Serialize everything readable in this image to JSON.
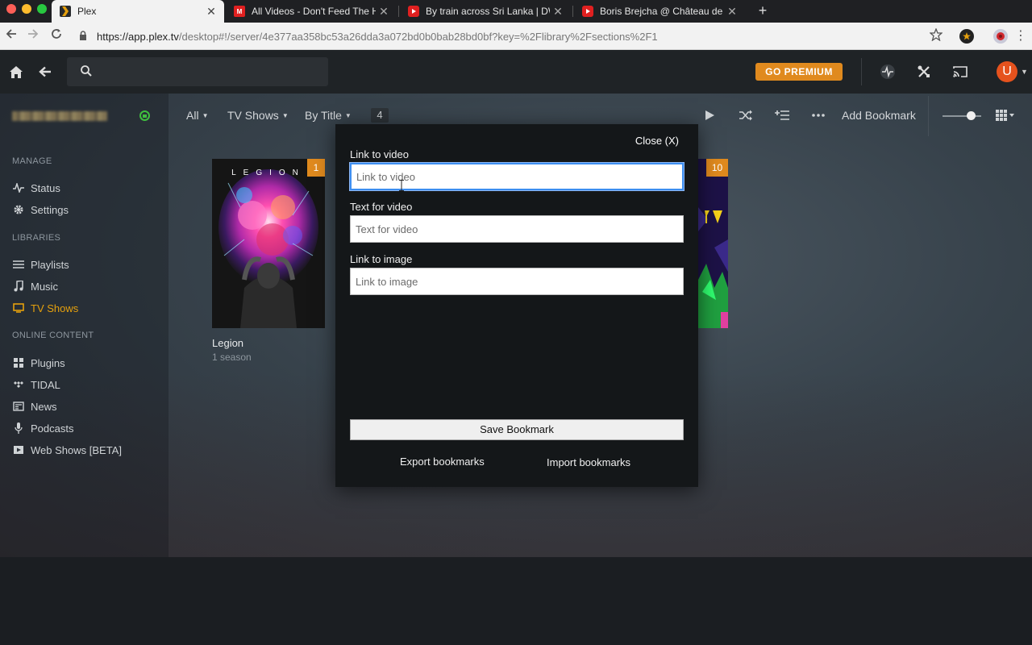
{
  "browser": {
    "tabs": [
      {
        "title": "Plex",
        "active": true,
        "favicon": "plex-icon"
      },
      {
        "title": "All Videos - Don't Feed The Hu",
        "active": false,
        "favicon": "mc-icon"
      },
      {
        "title": "By train across Sri Lanka | DW",
        "active": false,
        "favicon": "youtube-icon"
      },
      {
        "title": "Boris Brejcha @ Château de Fo",
        "active": false,
        "favicon": "youtube-icon"
      }
    ],
    "url_scheme": "https://",
    "url_host": "app.plex.tv",
    "url_rest": "/desktop#!/server/4e377aa358bc53a26dda3a072bd0b0bab28bd0bf?key=%2Flibrary%2Fsections%2F1"
  },
  "plex_header": {
    "premium_label": "GO PREMIUM",
    "avatar_letter": "U"
  },
  "sidebar": {
    "manage_label": "MANAGE",
    "manage_items": [
      {
        "label": "Status",
        "icon": "activity-icon"
      },
      {
        "label": "Settings",
        "icon": "gear-icon"
      }
    ],
    "libraries_label": "LIBRARIES",
    "library_items": [
      {
        "label": "Playlists",
        "icon": "list-icon"
      },
      {
        "label": "Music",
        "icon": "music-note-icon"
      },
      {
        "label": "TV Shows",
        "icon": "tv-icon",
        "active": true
      }
    ],
    "online_label": "ONLINE CONTENT",
    "online_items": [
      {
        "label": "Plugins",
        "icon": "grid-icon"
      },
      {
        "label": "TIDAL",
        "icon": "tidal-icon"
      },
      {
        "label": "News",
        "icon": "news-icon"
      },
      {
        "label": "Podcasts",
        "icon": "microphone-icon"
      },
      {
        "label": "Web Shows [BETA]",
        "icon": "play-box-icon"
      }
    ]
  },
  "toolbar": {
    "filter_all": "All",
    "filter_type": "TV Shows",
    "sort": "By Title",
    "count": "4",
    "add_bookmark": "Add Bookmark"
  },
  "library": {
    "items": [
      {
        "title": "Legion",
        "subtitle": "1 season",
        "badge": "1",
        "poster_text": "LEGION"
      },
      {
        "badge": "10"
      }
    ]
  },
  "modal": {
    "close_label": "Close (X)",
    "link_video_label": "Link to video",
    "link_video_placeholder": "Link to video",
    "text_video_label": "Text for video",
    "text_video_placeholder": "Text for video",
    "link_image_label": "Link to image",
    "link_image_placeholder": "Link to image",
    "save_label": "Save Bookmark",
    "export_label": "Export bookmarks",
    "import_label": "Import bookmarks"
  },
  "colors": {
    "accent": "#e5a00d",
    "premium": "#e08a1e",
    "focus_ring": "#3d8ef0"
  }
}
